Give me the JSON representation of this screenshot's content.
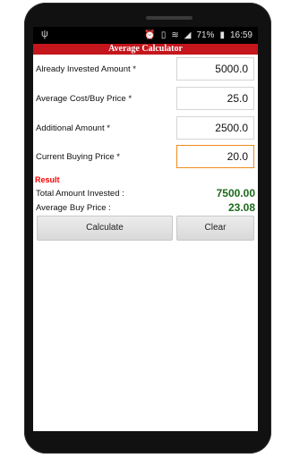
{
  "status_bar": {
    "usb_icon": "usb-icon",
    "icons": [
      "alarm-icon",
      "vibrate-icon",
      "wifi-icon",
      "signal-icon"
    ],
    "battery": "71%",
    "time": "16:59"
  },
  "app": {
    "title": "Average Calculator",
    "accent": "#c4161c"
  },
  "form": {
    "already_invested": {
      "label": "Already Invested Amount *",
      "value": "5000.0"
    },
    "average_cost": {
      "label": "Average Cost/Buy Price *",
      "value": "25.0"
    },
    "additional_amount": {
      "label": "Additional Amount *",
      "value": "2500.0"
    },
    "current_buying_price": {
      "label": "Current Buying Price *",
      "value": "20.0"
    }
  },
  "result": {
    "heading": "Result",
    "total_invested": {
      "label": "Total Amount Invested :",
      "value": "7500.00"
    },
    "average_buy_price": {
      "label": "Average Buy Price :",
      "value": "23.08"
    }
  },
  "buttons": {
    "calculate": "Calculate",
    "clear": "Clear"
  }
}
